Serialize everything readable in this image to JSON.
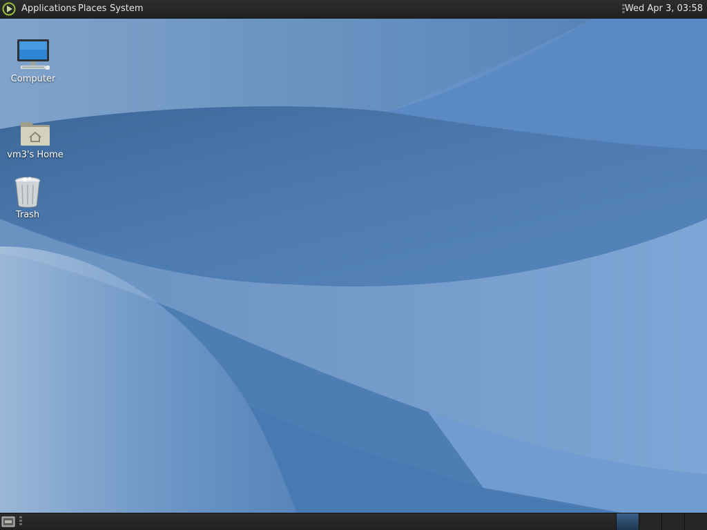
{
  "top_panel": {
    "menus": {
      "applications": "Applications",
      "places": "Places",
      "system": "System"
    },
    "clock": "Wed Apr  3, 03:58"
  },
  "desktop_icons": [
    {
      "label": "Computer",
      "icon": "computer-icon"
    },
    {
      "label": "vm3's Home",
      "icon": "home-folder-icon"
    },
    {
      "label": "Trash",
      "icon": "trash-icon"
    }
  ],
  "bottom_panel": {
    "show_desktop_icon": "show-desktop-icon",
    "workspaces": 4,
    "active_workspace": 1
  },
  "colors": {
    "panel": "#2b2d2e",
    "wallpaper": "#4a78ae",
    "text": "#ffffff"
  }
}
